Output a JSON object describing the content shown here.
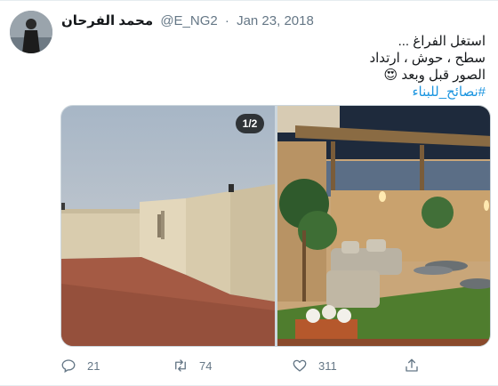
{
  "tweet": {
    "author_name": "محمد الفرحان",
    "handle": "@E_NG2",
    "separator": "·",
    "date": "Jan 23, 2018",
    "lines": [
      "استغل الفراغ ...",
      "سطح ، حوش ، ارتداد",
      "الصور قبل وبعد 😍"
    ],
    "hashtag": "#نصائح_للبناء",
    "media": {
      "counter": "1/2"
    },
    "actions": {
      "reply_count": "21",
      "retweet_count": "74",
      "like_count": "311"
    }
  },
  "icons": {
    "reply": "reply-icon",
    "retweet": "retweet-icon",
    "like": "heart-icon",
    "share": "share-icon"
  },
  "colors": {
    "text": "#14171a",
    "secondary": "#657786",
    "link": "#1b95e0"
  }
}
